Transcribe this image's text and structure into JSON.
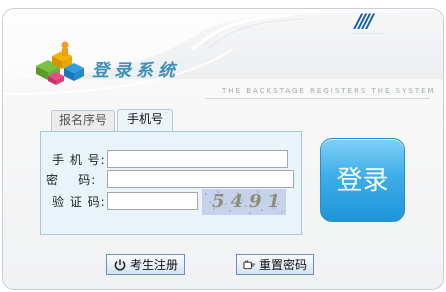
{
  "header": {
    "title": "登录系统",
    "subtitle": "THE BACKSTAGE REGISTERS THE SYSTEM",
    "brand_mark": "////",
    "brand_dots": "··········"
  },
  "tabs": [
    {
      "label": "报名序号",
      "active": false
    },
    {
      "label": "手机号",
      "active": true
    }
  ],
  "form": {
    "phone_label": "手 机 号:",
    "phone_value": "",
    "password_label": "密    码:",
    "password_value": "",
    "captcha_label": "验 证 码:",
    "captcha_value": "",
    "captcha_image_text": "5491"
  },
  "actions": {
    "login_label": "登录",
    "register_label": "考生注册",
    "reset_label": "重置密码"
  },
  "colors": {
    "login_button": "#3eaee9",
    "title": "#3d90b8",
    "form_background": "#e8f4fa"
  },
  "icons": {
    "logo": "colored-blocks-logo-icon",
    "register": "power-icon",
    "reset": "hand-pointer-icon"
  }
}
